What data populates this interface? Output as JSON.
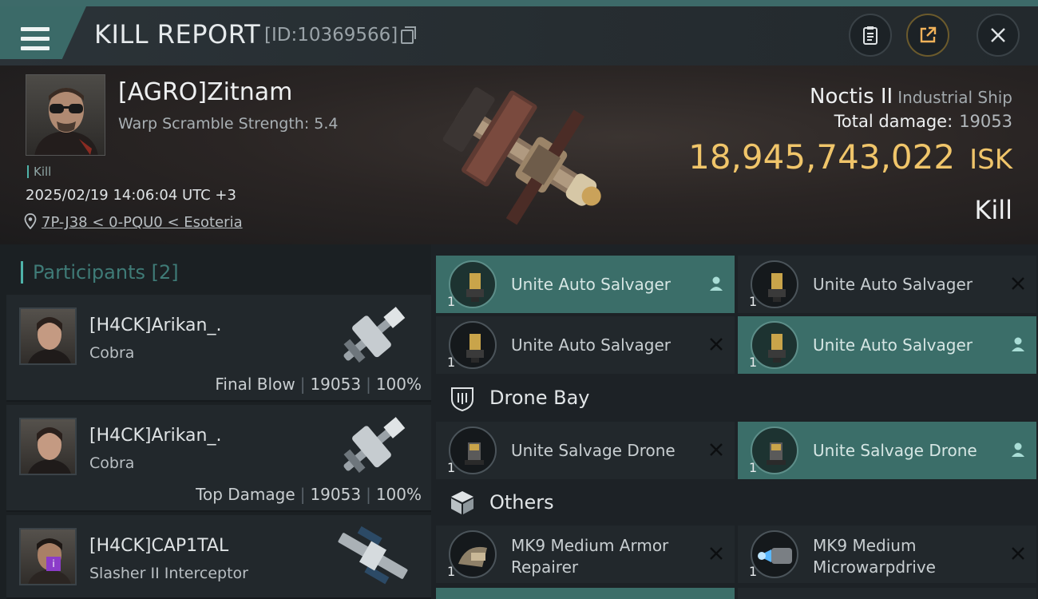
{
  "header": {
    "menu_icon": "hamburger-menu-icon",
    "title": "KILL REPORT",
    "report_id": "[ID:10369566]",
    "buttons": [
      "clipboard-icon",
      "share-icon",
      "close-icon"
    ]
  },
  "victim": {
    "name": "[AGRO]Zitnam",
    "subtitle": "Warp Scramble Strength: 5.4",
    "tag": "Kill",
    "timestamp": "2025/02/19 14:06:04 UTC +3",
    "location": "7P-J38 < 0-PQU0 < Esoteria"
  },
  "ship": {
    "name": "Noctis II",
    "class": "Industrial Ship",
    "total_damage_label": "Total damage:",
    "total_damage": "19053",
    "isk_value": "18,945,743,022",
    "isk_unit": "ISK",
    "result": "Kill"
  },
  "participants": {
    "title": "Participants [2]",
    "items": [
      {
        "name": "[H4CK]Arikan_.",
        "ship": "Cobra",
        "role": "Final Blow",
        "damage": "19053",
        "percent": "100%"
      },
      {
        "name": "[H4CK]Arikan_.",
        "ship": "Cobra",
        "role": "Top Damage",
        "damage": "19053",
        "percent": "100%"
      },
      {
        "name": "[H4CK]CAP1TAL",
        "ship": "Slasher II Interceptor",
        "badge": "i"
      }
    ]
  },
  "fitting": {
    "high_slots": [
      {
        "qty": "1",
        "name": "Unite Auto Salvager",
        "state": "dropped",
        "state_icon": "person-icon"
      },
      {
        "qty": "1",
        "name": "Unite Auto Salvager",
        "state": "destroyed",
        "state_icon": "x-icon"
      },
      {
        "qty": "1",
        "name": "Unite Auto Salvager",
        "state": "destroyed",
        "state_icon": "x-icon"
      },
      {
        "qty": "1",
        "name": "Unite Auto Salvager",
        "state": "dropped",
        "state_icon": "person-icon"
      }
    ],
    "drone_bay": {
      "title": "Drone Bay",
      "icon": "drone-bay-icon",
      "items": [
        {
          "qty": "1",
          "name": "Unite Salvage Drone",
          "state": "destroyed",
          "state_icon": "x-icon"
        },
        {
          "qty": "1",
          "name": "Unite Salvage Drone",
          "state": "dropped",
          "state_icon": "person-icon"
        }
      ]
    },
    "others": {
      "title": "Others",
      "icon": "cube-icon",
      "items": [
        {
          "qty": "1",
          "name_line1": "MK9 Medium Armor",
          "name_line2": "Repairer",
          "state": "destroyed",
          "state_icon": "x-icon"
        },
        {
          "qty": "1",
          "name_line1": "MK9 Medium",
          "name_line2": "Microwarpdrive",
          "state": "destroyed",
          "state_icon": "x-icon"
        }
      ]
    }
  },
  "colors": {
    "accent_teal": "#3b6e69",
    "isk_gold": "#f0c56a",
    "badge_purple": "#8b3cc9"
  }
}
